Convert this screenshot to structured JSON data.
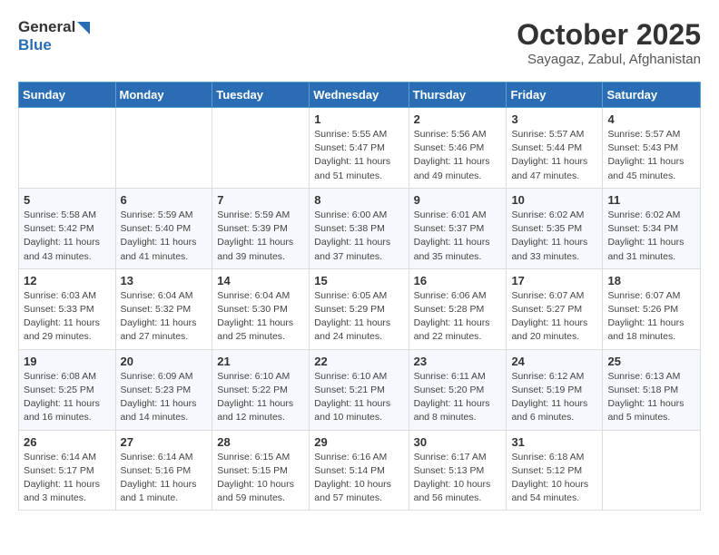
{
  "header": {
    "logo_line1": "General",
    "logo_line2": "Blue",
    "month": "October 2025",
    "location": "Sayagaz, Zabul, Afghanistan"
  },
  "weekdays": [
    "Sunday",
    "Monday",
    "Tuesday",
    "Wednesday",
    "Thursday",
    "Friday",
    "Saturday"
  ],
  "weeks": [
    [
      {
        "day": "",
        "detail": ""
      },
      {
        "day": "",
        "detail": ""
      },
      {
        "day": "",
        "detail": ""
      },
      {
        "day": "1",
        "detail": "Sunrise: 5:55 AM\nSunset: 5:47 PM\nDaylight: 11 hours\nand 51 minutes."
      },
      {
        "day": "2",
        "detail": "Sunrise: 5:56 AM\nSunset: 5:46 PM\nDaylight: 11 hours\nand 49 minutes."
      },
      {
        "day": "3",
        "detail": "Sunrise: 5:57 AM\nSunset: 5:44 PM\nDaylight: 11 hours\nand 47 minutes."
      },
      {
        "day": "4",
        "detail": "Sunrise: 5:57 AM\nSunset: 5:43 PM\nDaylight: 11 hours\nand 45 minutes."
      }
    ],
    [
      {
        "day": "5",
        "detail": "Sunrise: 5:58 AM\nSunset: 5:42 PM\nDaylight: 11 hours\nand 43 minutes."
      },
      {
        "day": "6",
        "detail": "Sunrise: 5:59 AM\nSunset: 5:40 PM\nDaylight: 11 hours\nand 41 minutes."
      },
      {
        "day": "7",
        "detail": "Sunrise: 5:59 AM\nSunset: 5:39 PM\nDaylight: 11 hours\nand 39 minutes."
      },
      {
        "day": "8",
        "detail": "Sunrise: 6:00 AM\nSunset: 5:38 PM\nDaylight: 11 hours\nand 37 minutes."
      },
      {
        "day": "9",
        "detail": "Sunrise: 6:01 AM\nSunset: 5:37 PM\nDaylight: 11 hours\nand 35 minutes."
      },
      {
        "day": "10",
        "detail": "Sunrise: 6:02 AM\nSunset: 5:35 PM\nDaylight: 11 hours\nand 33 minutes."
      },
      {
        "day": "11",
        "detail": "Sunrise: 6:02 AM\nSunset: 5:34 PM\nDaylight: 11 hours\nand 31 minutes."
      }
    ],
    [
      {
        "day": "12",
        "detail": "Sunrise: 6:03 AM\nSunset: 5:33 PM\nDaylight: 11 hours\nand 29 minutes."
      },
      {
        "day": "13",
        "detail": "Sunrise: 6:04 AM\nSunset: 5:32 PM\nDaylight: 11 hours\nand 27 minutes."
      },
      {
        "day": "14",
        "detail": "Sunrise: 6:04 AM\nSunset: 5:30 PM\nDaylight: 11 hours\nand 25 minutes."
      },
      {
        "day": "15",
        "detail": "Sunrise: 6:05 AM\nSunset: 5:29 PM\nDaylight: 11 hours\nand 24 minutes."
      },
      {
        "day": "16",
        "detail": "Sunrise: 6:06 AM\nSunset: 5:28 PM\nDaylight: 11 hours\nand 22 minutes."
      },
      {
        "day": "17",
        "detail": "Sunrise: 6:07 AM\nSunset: 5:27 PM\nDaylight: 11 hours\nand 20 minutes."
      },
      {
        "day": "18",
        "detail": "Sunrise: 6:07 AM\nSunset: 5:26 PM\nDaylight: 11 hours\nand 18 minutes."
      }
    ],
    [
      {
        "day": "19",
        "detail": "Sunrise: 6:08 AM\nSunset: 5:25 PM\nDaylight: 11 hours\nand 16 minutes."
      },
      {
        "day": "20",
        "detail": "Sunrise: 6:09 AM\nSunset: 5:23 PM\nDaylight: 11 hours\nand 14 minutes."
      },
      {
        "day": "21",
        "detail": "Sunrise: 6:10 AM\nSunset: 5:22 PM\nDaylight: 11 hours\nand 12 minutes."
      },
      {
        "day": "22",
        "detail": "Sunrise: 6:10 AM\nSunset: 5:21 PM\nDaylight: 11 hours\nand 10 minutes."
      },
      {
        "day": "23",
        "detail": "Sunrise: 6:11 AM\nSunset: 5:20 PM\nDaylight: 11 hours\nand 8 minutes."
      },
      {
        "day": "24",
        "detail": "Sunrise: 6:12 AM\nSunset: 5:19 PM\nDaylight: 11 hours\nand 6 minutes."
      },
      {
        "day": "25",
        "detail": "Sunrise: 6:13 AM\nSunset: 5:18 PM\nDaylight: 11 hours\nand 5 minutes."
      }
    ],
    [
      {
        "day": "26",
        "detail": "Sunrise: 6:14 AM\nSunset: 5:17 PM\nDaylight: 11 hours\nand 3 minutes."
      },
      {
        "day": "27",
        "detail": "Sunrise: 6:14 AM\nSunset: 5:16 PM\nDaylight: 11 hours\nand 1 minute."
      },
      {
        "day": "28",
        "detail": "Sunrise: 6:15 AM\nSunset: 5:15 PM\nDaylight: 10 hours\nand 59 minutes."
      },
      {
        "day": "29",
        "detail": "Sunrise: 6:16 AM\nSunset: 5:14 PM\nDaylight: 10 hours\nand 57 minutes."
      },
      {
        "day": "30",
        "detail": "Sunrise: 6:17 AM\nSunset: 5:13 PM\nDaylight: 10 hours\nand 56 minutes."
      },
      {
        "day": "31",
        "detail": "Sunrise: 6:18 AM\nSunset: 5:12 PM\nDaylight: 10 hours\nand 54 minutes."
      },
      {
        "day": "",
        "detail": ""
      }
    ]
  ]
}
